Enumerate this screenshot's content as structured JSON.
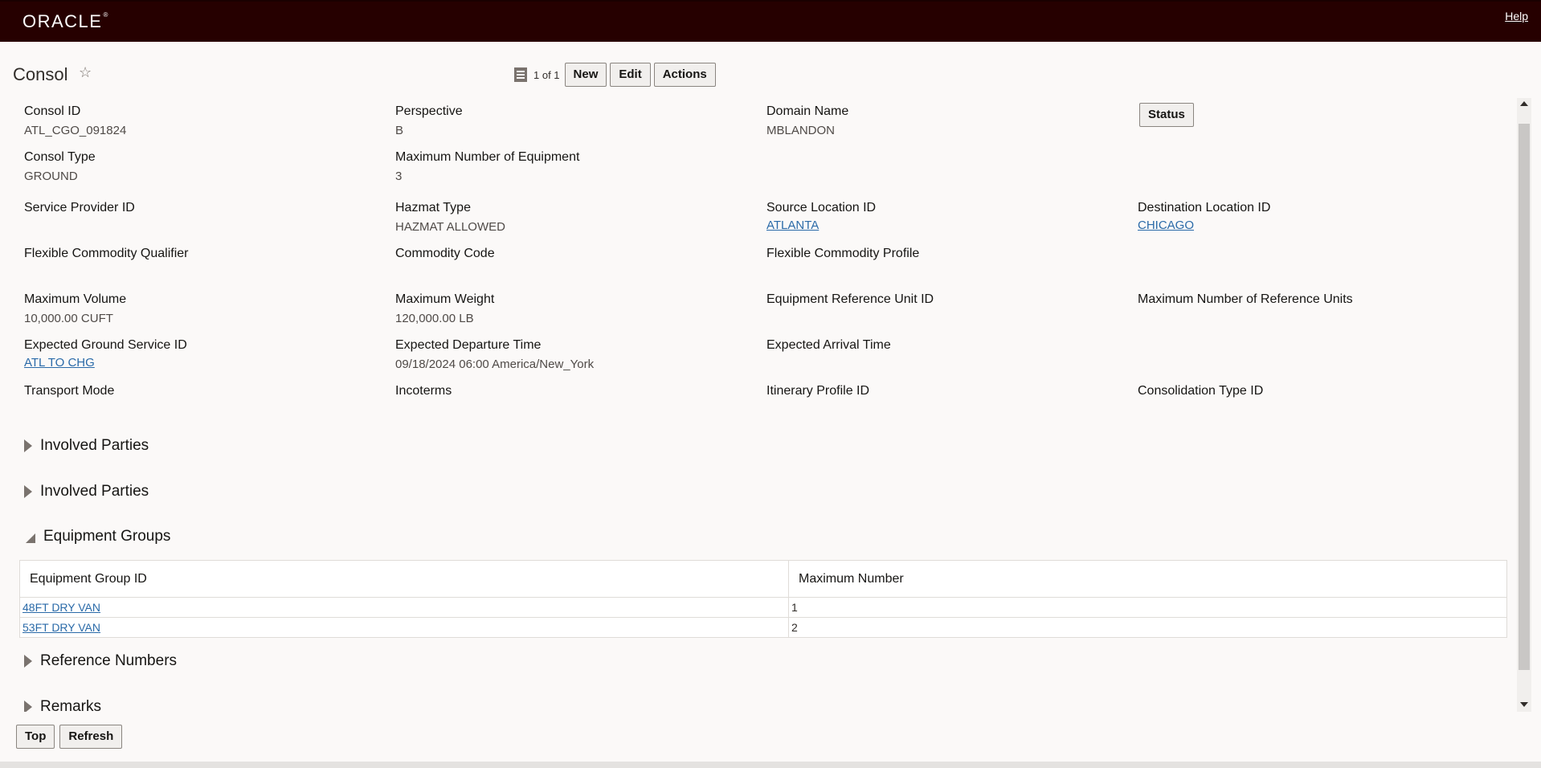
{
  "header": {
    "logo_text": "ORACLE",
    "logo_mark": "®",
    "help_label": "Help"
  },
  "page": {
    "title": "Consol"
  },
  "toolbar": {
    "record_count": "1 of 1",
    "new_label": "New",
    "edit_label": "Edit",
    "actions_label": "Actions"
  },
  "fields": {
    "consol_id": {
      "label": "Consol ID",
      "value": "ATL_CGO_091824"
    },
    "perspective": {
      "label": "Perspective",
      "value": "B"
    },
    "domain_name": {
      "label": "Domain Name",
      "value": "MBLANDON"
    },
    "status_label": "Status",
    "consol_type": {
      "label": "Consol Type",
      "value": "GROUND"
    },
    "max_equipment": {
      "label": "Maximum Number of Equipment",
      "value": "3"
    },
    "service_provider_id": {
      "label": "Service Provider ID",
      "value": ""
    },
    "hazmat_type": {
      "label": "Hazmat Type",
      "value": "HAZMAT ALLOWED"
    },
    "source_location_id": {
      "label": "Source Location ID",
      "value": "ATLANTA"
    },
    "destination_location_id": {
      "label": "Destination Location ID",
      "value": "CHICAGO"
    },
    "flexible_commodity_qualifier": {
      "label": "Flexible Commodity Qualifier",
      "value": ""
    },
    "commodity_code": {
      "label": "Commodity Code",
      "value": ""
    },
    "flexible_commodity_profile": {
      "label": "Flexible Commodity Profile",
      "value": ""
    },
    "max_volume": {
      "label": "Maximum Volume",
      "value": "10,000.00 CUFT"
    },
    "max_weight": {
      "label": "Maximum Weight",
      "value": "120,000.00 LB"
    },
    "equipment_reference_unit_id": {
      "label": "Equipment Reference Unit ID",
      "value": ""
    },
    "max_reference_units": {
      "label": "Maximum Number of Reference Units",
      "value": ""
    },
    "expected_ground_service_id": {
      "label": "Expected Ground Service ID",
      "value": "ATL TO CHG"
    },
    "expected_departure_time": {
      "label": "Expected Departure Time",
      "value": "09/18/2024 06:00 America/New_York"
    },
    "expected_arrival_time": {
      "label": "Expected Arrival Time",
      "value": ""
    },
    "transport_mode": {
      "label": "Transport Mode",
      "value": ""
    },
    "incoterms": {
      "label": "Incoterms",
      "value": ""
    },
    "itinerary_profile_id": {
      "label": "Itinerary Profile ID",
      "value": ""
    },
    "consolidation_type_id": {
      "label": "Consolidation Type ID",
      "value": ""
    }
  },
  "sections": {
    "involved_parties_1": "Involved Parties",
    "involved_parties_2": "Involved Parties",
    "equipment_groups": "Equipment Groups",
    "reference_numbers": "Reference Numbers",
    "remarks": "Remarks"
  },
  "equipment_table": {
    "headers": [
      "Equipment Group ID",
      "Maximum Number"
    ],
    "rows": [
      {
        "id": "48FT DRY VAN",
        "max": "1"
      },
      {
        "id": "53FT DRY VAN",
        "max": "2"
      }
    ]
  },
  "bottom": {
    "top_label": "Top",
    "refresh_label": "Refresh"
  }
}
